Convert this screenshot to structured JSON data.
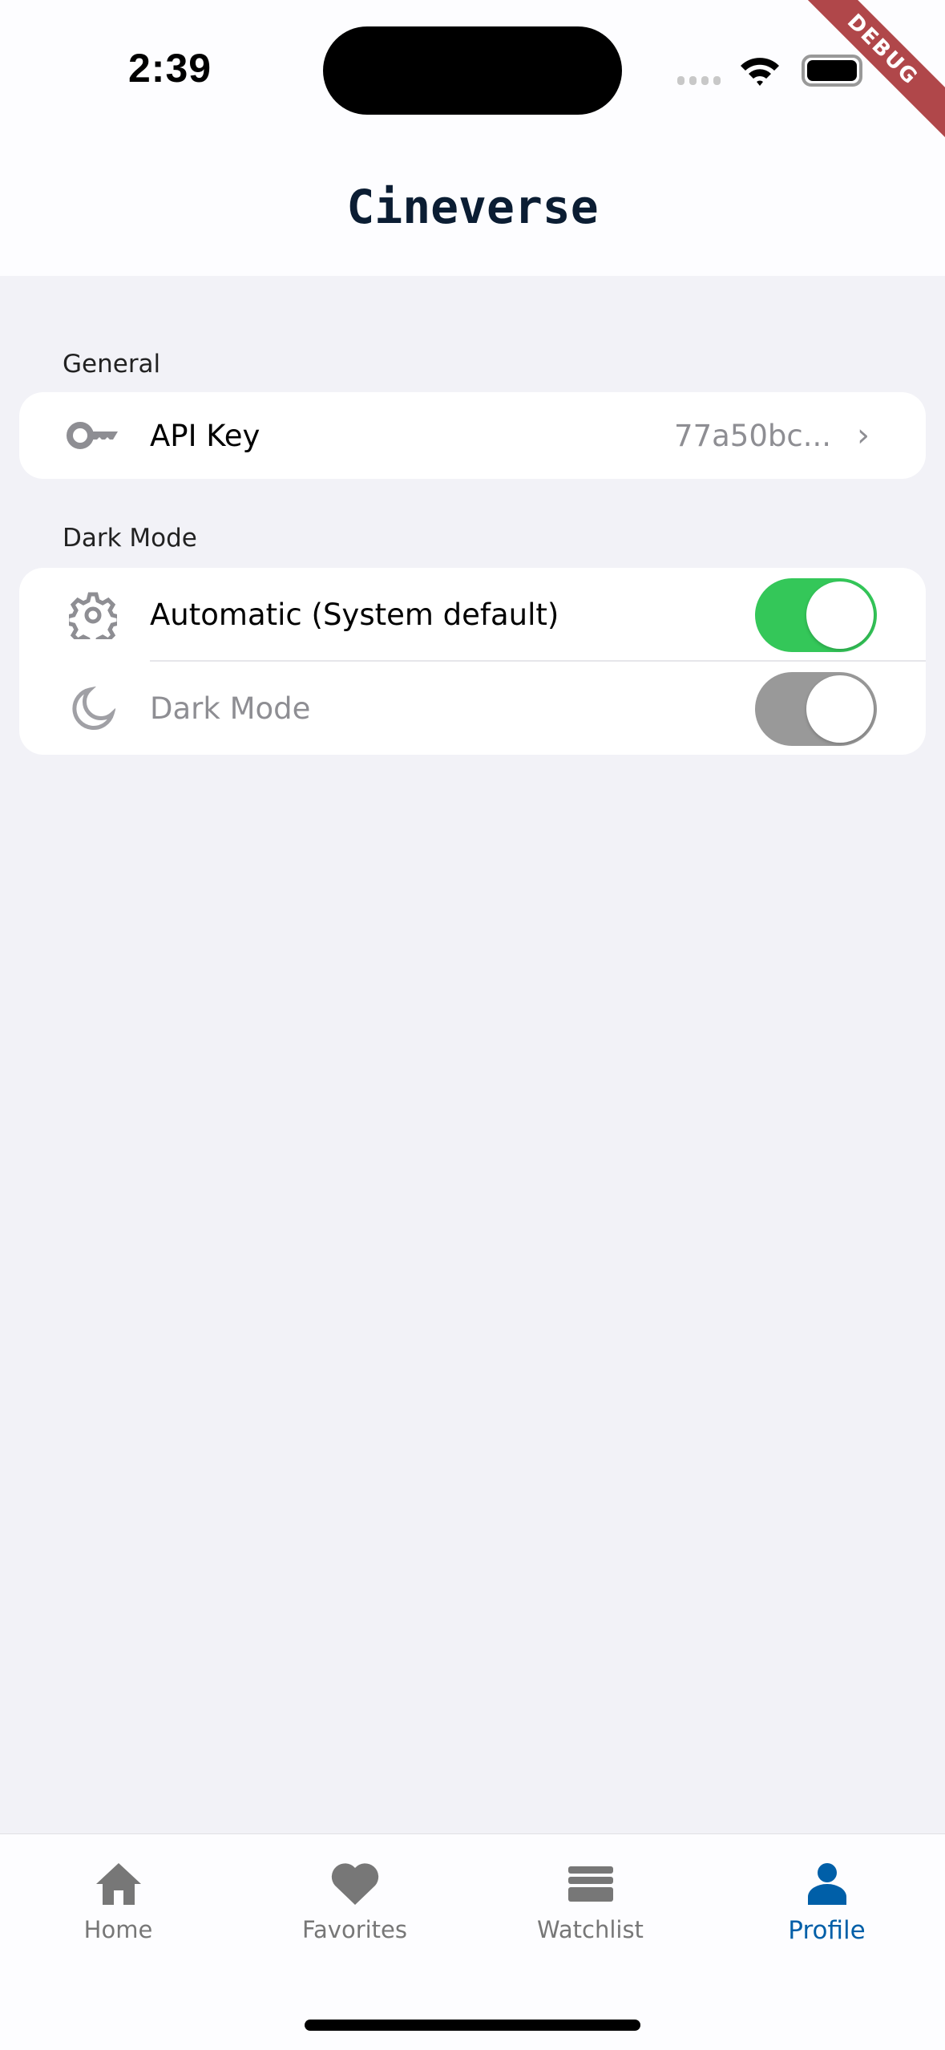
{
  "status_bar": {
    "time": "2:39"
  },
  "debug_banner": "DEBUG",
  "header": {
    "title": "Cineverse"
  },
  "sections": [
    {
      "title": "General",
      "rows": [
        {
          "icon": "key-icon",
          "label": "API Key",
          "value": "77a50bc..."
        }
      ]
    },
    {
      "title": "Dark Mode",
      "rows": [
        {
          "icon": "gear-icon",
          "label": "Automatic (System default)",
          "toggle_on": true,
          "enabled": true
        },
        {
          "icon": "moon-icon",
          "label": "Dark Mode",
          "toggle_on": true,
          "enabled": false
        }
      ]
    }
  ],
  "tabs": [
    {
      "label": "Home",
      "icon": "home-icon",
      "active": false
    },
    {
      "label": "Favorites",
      "icon": "heart-icon",
      "active": false
    },
    {
      "label": "Watchlist",
      "icon": "list-icon",
      "active": false
    },
    {
      "label": "Profile",
      "icon": "person-icon",
      "active": true
    }
  ],
  "colors": {
    "accent": "#005fa8",
    "toggle_on": "#34c759",
    "toggle_disabled": "#999999",
    "icon_gray": "#777777"
  }
}
